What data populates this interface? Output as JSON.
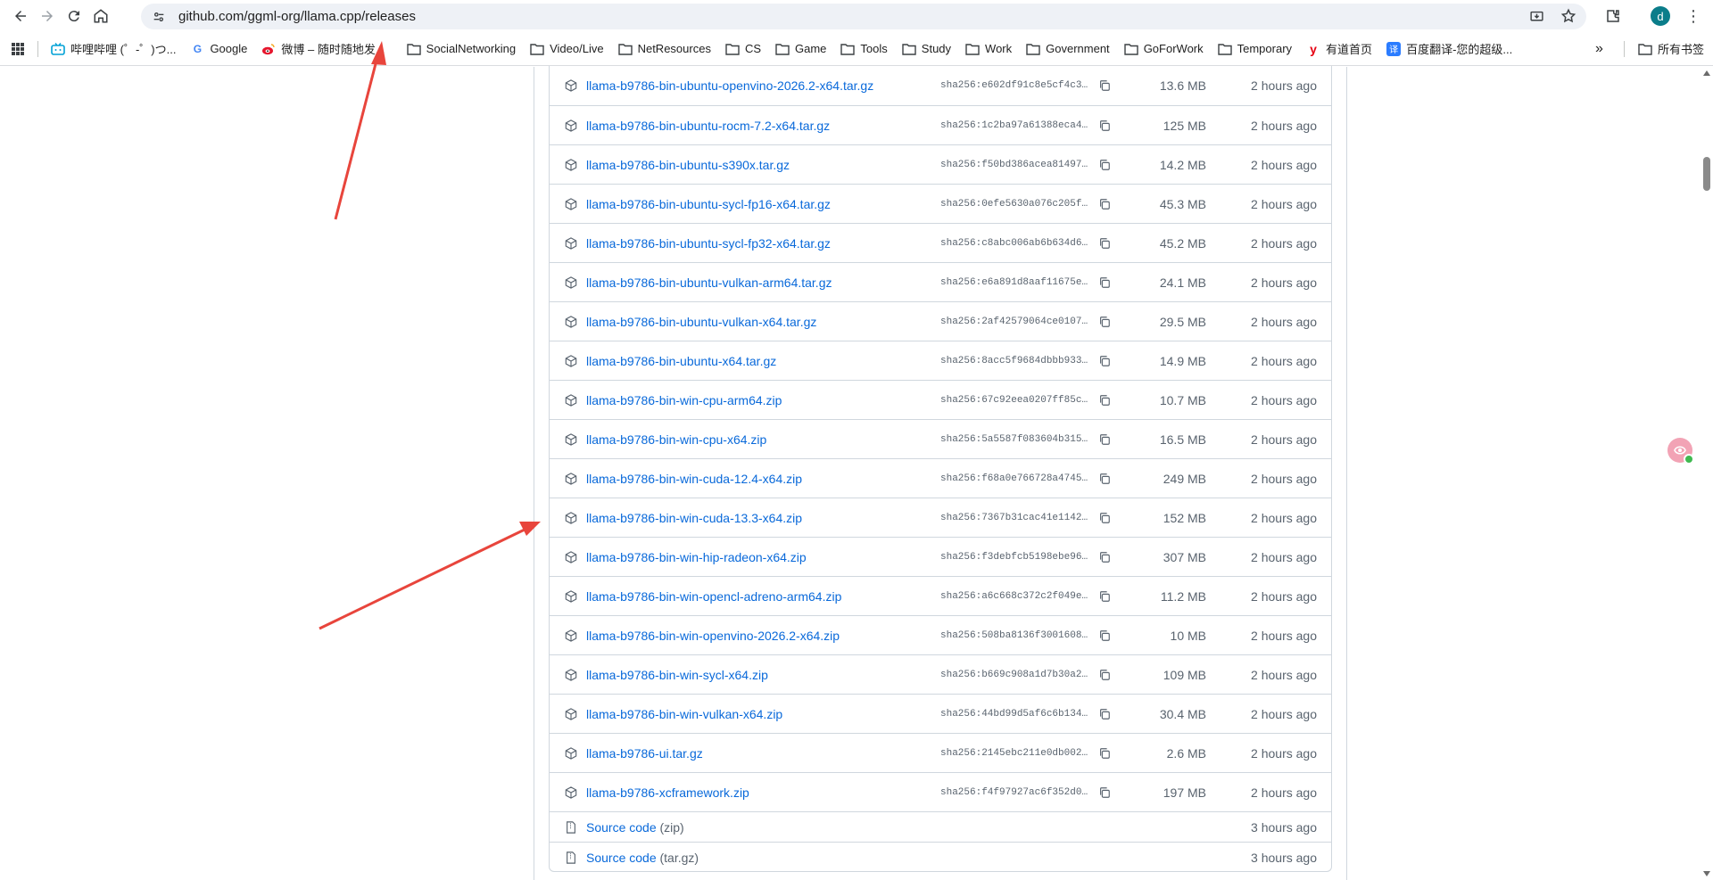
{
  "browser": {
    "url": "github.com/ggml-org/llama.cpp/releases",
    "avatar_letter": "d",
    "bookmarks": [
      {
        "label": "哔哩哔哩 (゜-゜)つ...",
        "icon": "bilibili-icon"
      },
      {
        "label": "Google",
        "icon": "google-icon"
      },
      {
        "label": "微博 – 随时随地发...",
        "icon": "weibo-icon"
      },
      {
        "label": "SocialNetworking",
        "icon": "folder-icon"
      },
      {
        "label": "Video/Live",
        "icon": "folder-icon"
      },
      {
        "label": "NetResources",
        "icon": "folder-icon"
      },
      {
        "label": "CS",
        "icon": "folder-icon"
      },
      {
        "label": "Game",
        "icon": "folder-icon"
      },
      {
        "label": "Tools",
        "icon": "folder-icon"
      },
      {
        "label": "Study",
        "icon": "folder-icon"
      },
      {
        "label": "Work",
        "icon": "folder-icon"
      },
      {
        "label": "Government",
        "icon": "folder-icon"
      },
      {
        "label": "GoForWork",
        "icon": "folder-icon"
      },
      {
        "label": "Temporary",
        "icon": "folder-icon"
      },
      {
        "label": "有道首页",
        "icon": "youdao-icon"
      },
      {
        "label": "百度翻译-您的超级...",
        "icon": "baidu-translate-icon"
      }
    ],
    "overflow_label": "»",
    "all_bookmarks": "所有书签"
  },
  "assets": [
    {
      "name": "llama-b9786-bin-ubuntu-openvino-2026.2-x64.tar.gz",
      "sha": "sha256:e602df91c8e5cf4c3...",
      "size": "13.6 MB",
      "time": "2 hours ago"
    },
    {
      "name": "llama-b9786-bin-ubuntu-rocm-7.2-x64.tar.gz",
      "sha": "sha256:1c2ba97a61388eca4...",
      "size": "125 MB",
      "time": "2 hours ago"
    },
    {
      "name": "llama-b9786-bin-ubuntu-s390x.tar.gz",
      "sha": "sha256:f50bd386acea81497...",
      "size": "14.2 MB",
      "time": "2 hours ago"
    },
    {
      "name": "llama-b9786-bin-ubuntu-sycl-fp16-x64.tar.gz",
      "sha": "sha256:0efe5630a076c205f...",
      "size": "45.3 MB",
      "time": "2 hours ago"
    },
    {
      "name": "llama-b9786-bin-ubuntu-sycl-fp32-x64.tar.gz",
      "sha": "sha256:c8abc006ab6b634d6...",
      "size": "45.2 MB",
      "time": "2 hours ago"
    },
    {
      "name": "llama-b9786-bin-ubuntu-vulkan-arm64.tar.gz",
      "sha": "sha256:e6a891d8aaf11675e...",
      "size": "24.1 MB",
      "time": "2 hours ago"
    },
    {
      "name": "llama-b9786-bin-ubuntu-vulkan-x64.tar.gz",
      "sha": "sha256:2af42579064ce0107...",
      "size": "29.5 MB",
      "time": "2 hours ago"
    },
    {
      "name": "llama-b9786-bin-ubuntu-x64.tar.gz",
      "sha": "sha256:8acc5f9684dbbb933...",
      "size": "14.9 MB",
      "time": "2 hours ago"
    },
    {
      "name": "llama-b9786-bin-win-cpu-arm64.zip",
      "sha": "sha256:67c92eea0207ff85c...",
      "size": "10.7 MB",
      "time": "2 hours ago"
    },
    {
      "name": "llama-b9786-bin-win-cpu-x64.zip",
      "sha": "sha256:5a5587f083604b315...",
      "size": "16.5 MB",
      "time": "2 hours ago"
    },
    {
      "name": "llama-b9786-bin-win-cuda-12.4-x64.zip",
      "sha": "sha256:f68a0e766728a4745...",
      "size": "249 MB",
      "time": "2 hours ago"
    },
    {
      "name": "llama-b9786-bin-win-cuda-13.3-x64.zip",
      "sha": "sha256:7367b31cac41e1142...",
      "size": "152 MB",
      "time": "2 hours ago"
    },
    {
      "name": "llama-b9786-bin-win-hip-radeon-x64.zip",
      "sha": "sha256:f3debfcb5198ebe96...",
      "size": "307 MB",
      "time": "2 hours ago"
    },
    {
      "name": "llama-b9786-bin-win-opencl-adreno-arm64.zip",
      "sha": "sha256:a6c668c372c2f049e...",
      "size": "11.2 MB",
      "time": "2 hours ago"
    },
    {
      "name": "llama-b9786-bin-win-openvino-2026.2-x64.zip",
      "sha": "sha256:508ba8136f3001608...",
      "size": "10 MB",
      "time": "2 hours ago"
    },
    {
      "name": "llama-b9786-bin-win-sycl-x64.zip",
      "sha": "sha256:b669c908a1d7b30a2...",
      "size": "109 MB",
      "time": "2 hours ago"
    },
    {
      "name": "llama-b9786-bin-win-vulkan-x64.zip",
      "sha": "sha256:44bd99d5af6c6b134...",
      "size": "30.4 MB",
      "time": "2 hours ago"
    },
    {
      "name": "llama-b9786-ui.tar.gz",
      "sha": "sha256:2145ebc211e0db002...",
      "size": "2.6 MB",
      "time": "2 hours ago"
    },
    {
      "name": "llama-b9786-xcframework.zip",
      "sha": "sha256:f4f97927ac6f352d0...",
      "size": "197 MB",
      "time": "2 hours ago"
    }
  ],
  "source_code": [
    {
      "label": "Source code",
      "format": "(zip)",
      "time": "3 hours ago"
    },
    {
      "label": "Source code",
      "format": "(tar.gz)",
      "time": "3 hours ago"
    }
  ],
  "colors": {
    "link": "#0969da",
    "muted": "#59636e",
    "annotation_arrow": "#e8453c"
  }
}
